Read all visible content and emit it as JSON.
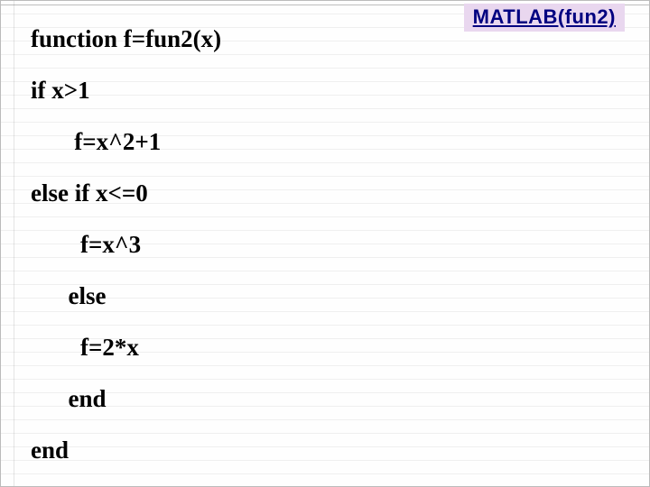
{
  "badge": {
    "label": "MATLAB(fun2)"
  },
  "code": {
    "lines": [
      "function f=fun2(x)",
      "if x>1",
      "   f=x^2+1",
      "else if x<=0",
      "    f=x^3",
      "  else",
      "    f=2*x",
      "  end",
      "end"
    ]
  }
}
